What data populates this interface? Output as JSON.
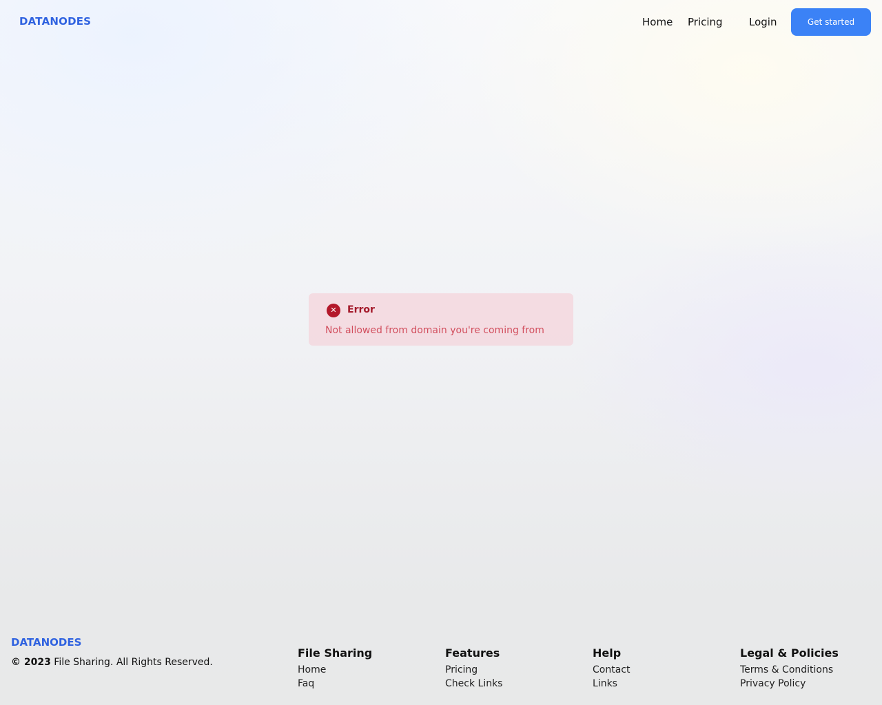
{
  "header": {
    "brand": "DATANODES",
    "nav": {
      "home": "Home",
      "pricing": "Pricing",
      "login": "Login"
    },
    "cta_label": "Get started",
    "cta_color": "#3b82f6",
    "brand_color": "#2f62e0"
  },
  "alert": {
    "icon": "x-circle-icon",
    "title": "Error",
    "message": "Not allowed from domain you're coming from",
    "background_color": "#f6ced6",
    "title_color": "#a3192a",
    "message_color": "#d24f5e"
  },
  "footer": {
    "brand": "DATANODES",
    "copyright_year": "© 2023",
    "copyright_text": "File Sharing. All Rights Reserved.",
    "columns": [
      {
        "heading": "File Sharing",
        "links": [
          "Home",
          "Faq"
        ]
      },
      {
        "heading": "Features",
        "links": [
          "Pricing",
          "Check Links"
        ]
      },
      {
        "heading": "Help",
        "links": [
          "Contact",
          "Links"
        ]
      },
      {
        "heading": "Legal & Policies",
        "links": [
          "Terms & Conditions",
          "Privacy Policy"
        ]
      }
    ]
  }
}
